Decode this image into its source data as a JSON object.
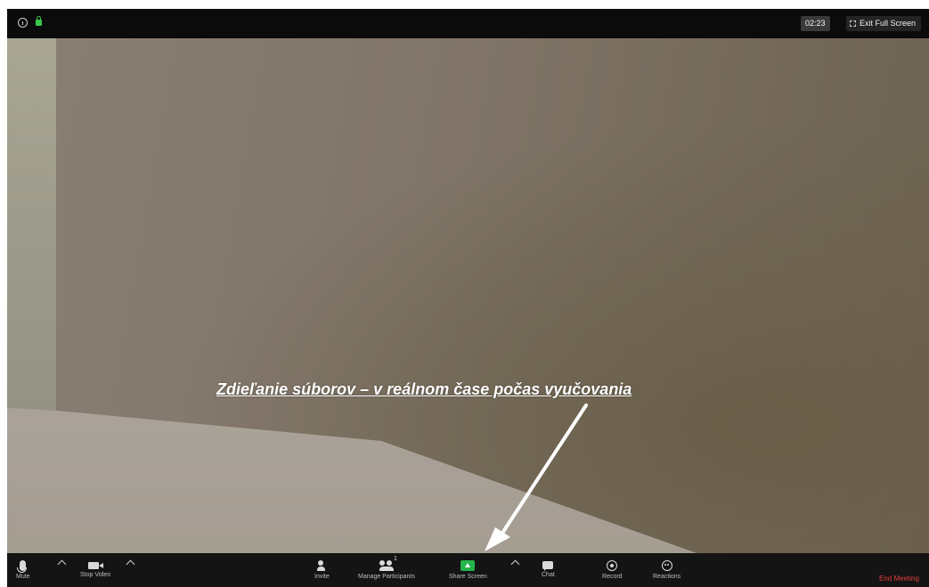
{
  "topbar": {
    "timer": "02:23",
    "exit_fullscreen": "Exit Full Screen"
  },
  "video": {
    "annotation": "Zdieľanie súborov – v reálnom čase počas vyučovania"
  },
  "toolbar": {
    "mute": "Mute",
    "stop_video": "Stop Video",
    "invite": "Invite",
    "manage_participants": "Manage Participants",
    "participant_count": "1",
    "share_screen": "Share Screen",
    "chat": "Chat",
    "record": "Record",
    "reactions": "Reactions",
    "end_meeting": "End Meeting"
  },
  "colors": {
    "share_green": "#25b34b",
    "end_red": "#e53b3b",
    "lock_green": "#37c64a"
  }
}
